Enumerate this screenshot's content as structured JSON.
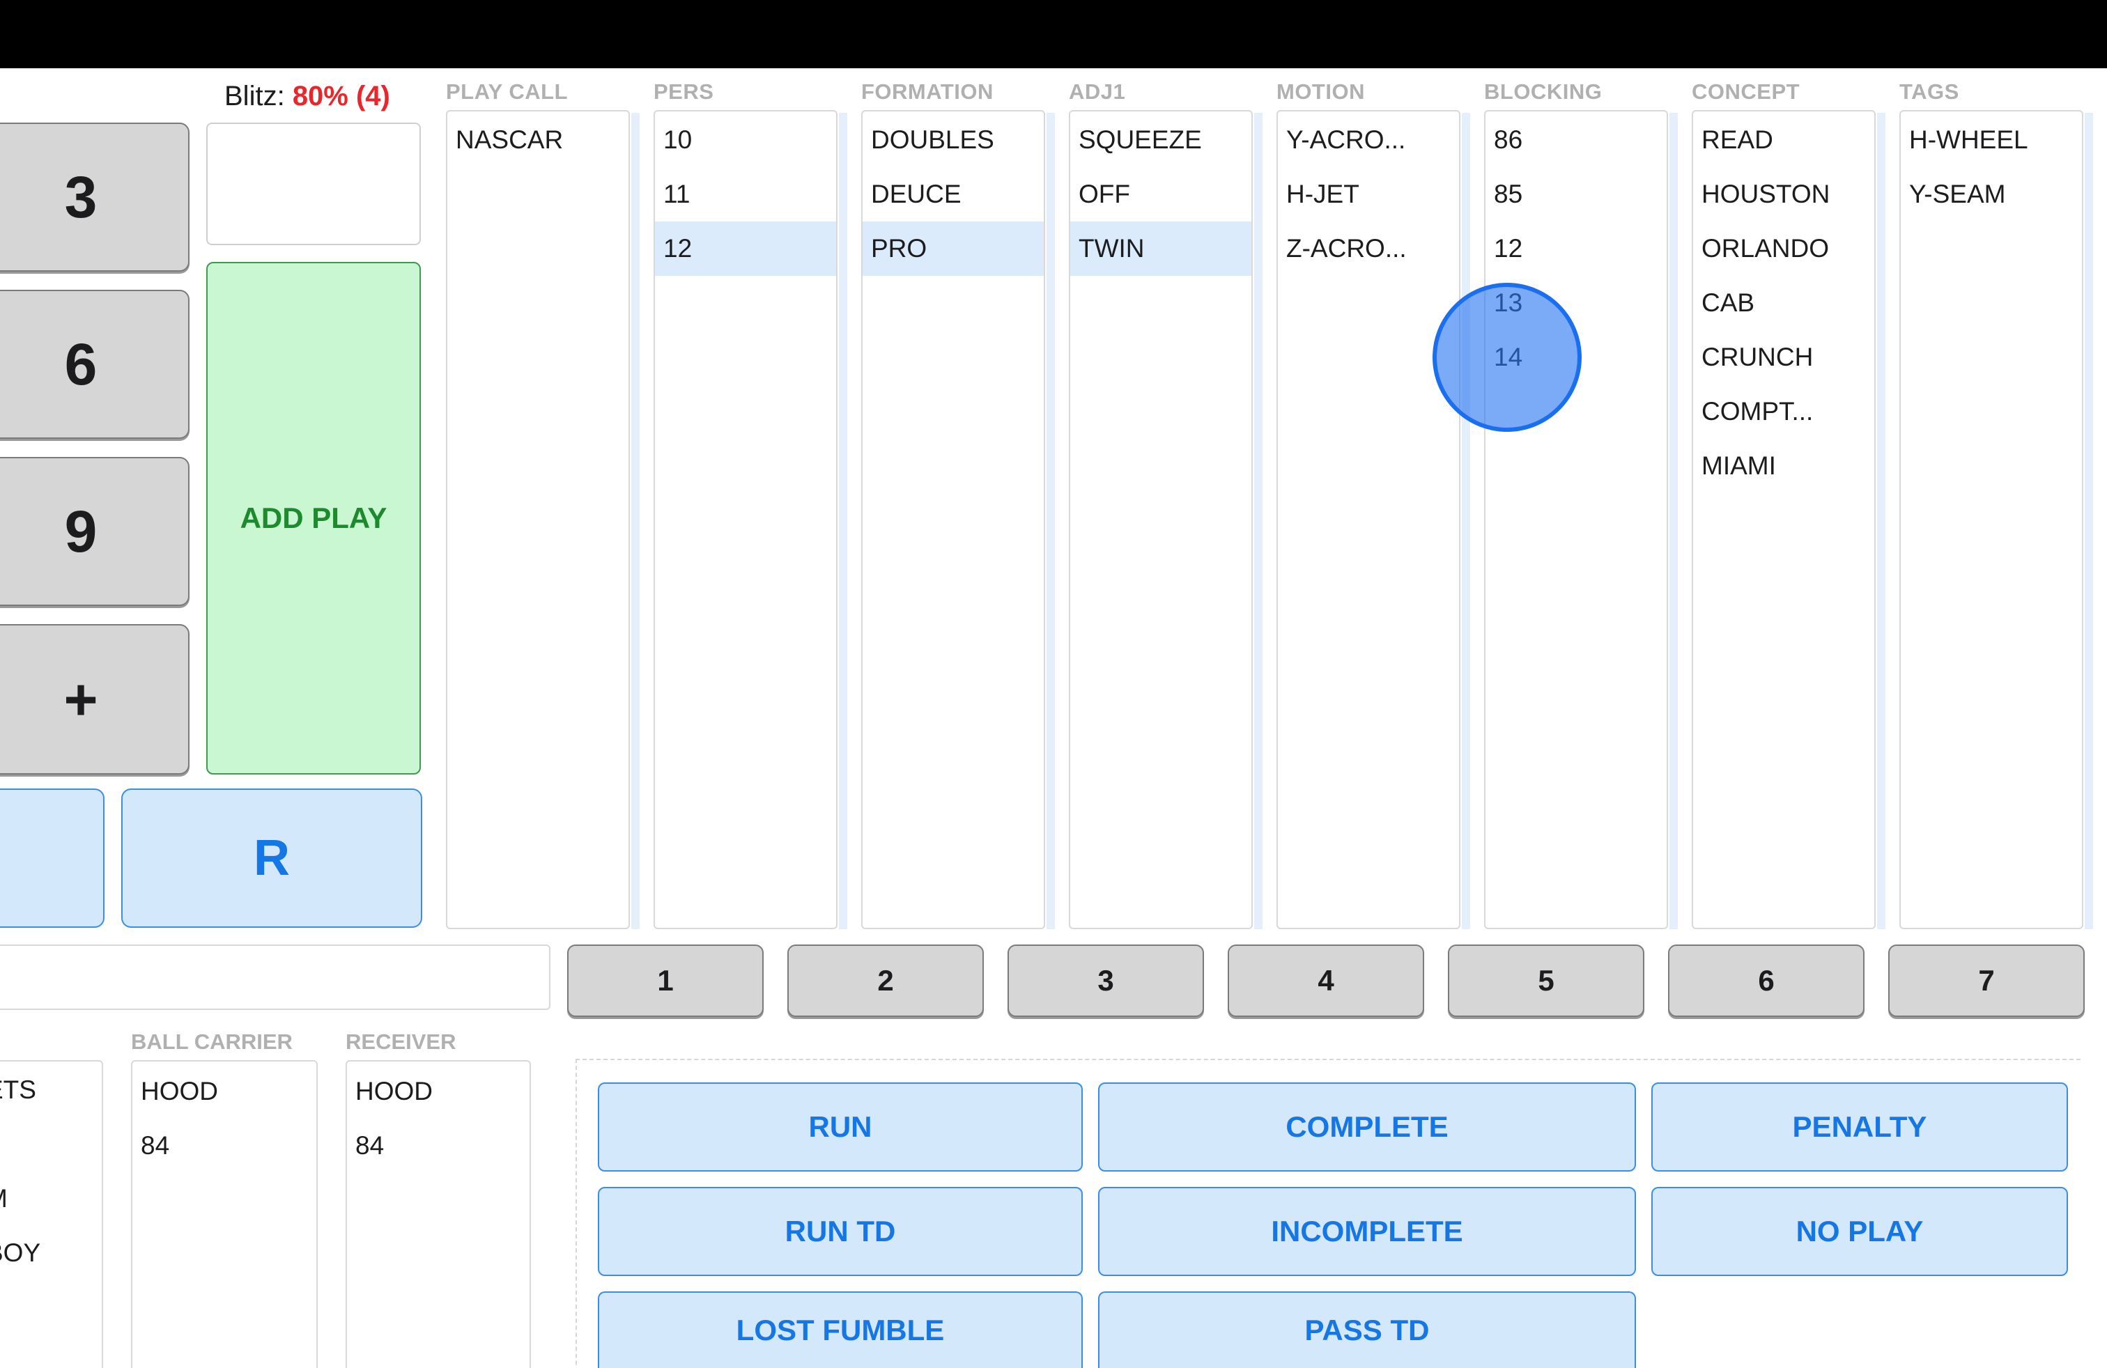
{
  "keypad": [
    "3",
    "6",
    "9",
    "+"
  ],
  "hash_r_label": "R",
  "blitz": {
    "label": "Blitz:",
    "value": "80% (4)"
  },
  "add_play_label": "ADD PLAY",
  "columns": [
    {
      "header": "PLAY CALL",
      "items": [
        "NASCAR"
      ],
      "selected": -1
    },
    {
      "header": "PERS",
      "items": [
        "10",
        "11",
        "12"
      ],
      "selected": 2
    },
    {
      "header": "FORMATION",
      "items": [
        "DOUBLES",
        "DEUCE",
        "PRO"
      ],
      "selected": 2
    },
    {
      "header": "ADJ1",
      "items": [
        "SQUEEZE",
        "OFF",
        "TWIN"
      ],
      "selected": 2
    },
    {
      "header": "MOTION",
      "items": [
        "Y-ACRO...",
        "H-JET",
        "Z-ACRO..."
      ],
      "selected": -1
    },
    {
      "header": "BLOCKING",
      "items": [
        "86",
        "85",
        "12",
        "13",
        "14"
      ],
      "selected": -1
    },
    {
      "header": "CONCEPT",
      "items": [
        "READ",
        "HOUSTON",
        "ORLANDO",
        "CAB",
        "CRUNCH",
        "COMPT...",
        "MIAMI"
      ],
      "selected": -1
    },
    {
      "header": "TAGS",
      "items": [
        "H-WHEEL",
        "Y-SEAM"
      ],
      "selected": -1
    }
  ],
  "number_row": [
    "1",
    "2",
    "3",
    "4",
    "5",
    "6",
    "7"
  ],
  "partial_list": {
    "items": [
      "ETS",
      "M",
      "BOY"
    ]
  },
  "ball_carrier": {
    "header": "BALL CARRIER",
    "items": [
      "HOOD",
      "84"
    ]
  },
  "receiver": {
    "header": "RECEIVER",
    "items": [
      "HOOD",
      "84"
    ]
  },
  "results": {
    "run": "RUN",
    "complete": "COMPLETE",
    "penalty": "PENALTY",
    "run_td": "RUN TD",
    "incomplete": "INCOMPLETE",
    "no_play": "NO PLAY",
    "lost_fumble": "LOST FUMBLE",
    "pass_td": "PASS TD"
  },
  "colors": {
    "accent_blue": "#1576e6",
    "blitz_red": "#e8262c",
    "add_play_green": "#1e8a2e",
    "touch_indicator": "#1a6ff0"
  }
}
